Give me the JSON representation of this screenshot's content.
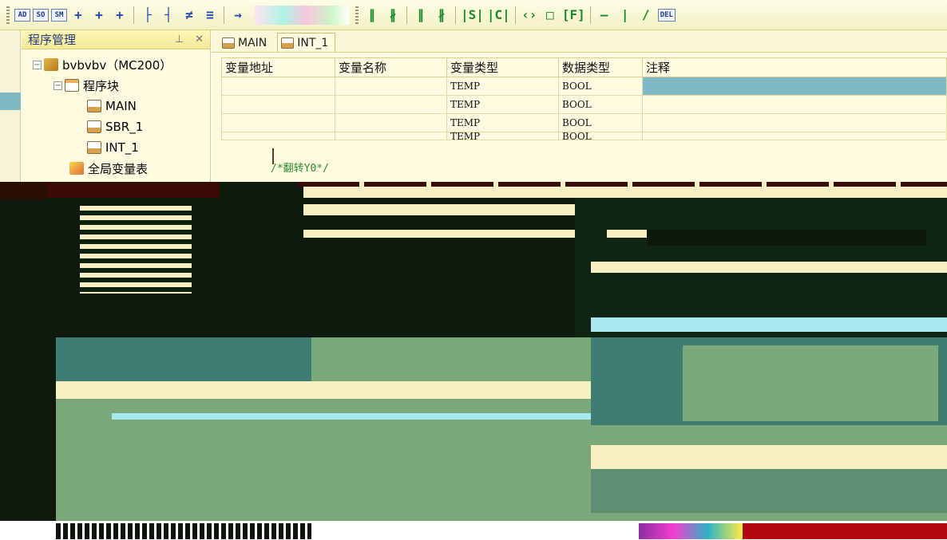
{
  "toolbar": {
    "small_buttons": [
      "AD",
      "SO",
      "SM"
    ],
    "ladder_buttons": [
      "+",
      "+",
      "+",
      "├",
      "┤",
      "≠",
      "≡",
      "→"
    ],
    "contact_buttons": [
      "∥",
      "∦",
      "∥",
      "∦",
      "|S|",
      "|C|"
    ],
    "coil_buttons": [
      "‹›",
      "□",
      "[F]"
    ],
    "line_buttons": [
      "—",
      "|",
      "∕",
      "DEL"
    ]
  },
  "panel": {
    "title": "程序管理",
    "pin": "⊥",
    "close": "✕",
    "tree": {
      "project": "bvbvbv（MC200）",
      "program_block": "程序块",
      "items": [
        "MAIN",
        "SBR_1",
        "INT_1"
      ],
      "global_vars": "全局变量表"
    }
  },
  "editor": {
    "tabs": [
      "MAIN",
      "INT_1"
    ],
    "active_tab": "INT_1",
    "table": {
      "headers": [
        "变量地址",
        "变量名称",
        "变量类型",
        "数据类型",
        "注释"
      ],
      "rows": [
        [
          "",
          "",
          "TEMP",
          "BOOL",
          ""
        ],
        [
          "",
          "",
          "TEMP",
          "BOOL",
          ""
        ],
        [
          "",
          "",
          "TEMP",
          "BOOL",
          ""
        ],
        [
          "",
          "",
          "TEMP",
          "BOOL",
          ""
        ]
      ]
    },
    "code_comment": "/*翻转Y0*/"
  },
  "colors": {
    "toolbar_bg": "#f7f4cf",
    "panel_bg": "#fffbe0",
    "selection": "#7fb9c6",
    "ladder_green": "#1a8a2a",
    "comment_green": "#2c8b2c"
  }
}
